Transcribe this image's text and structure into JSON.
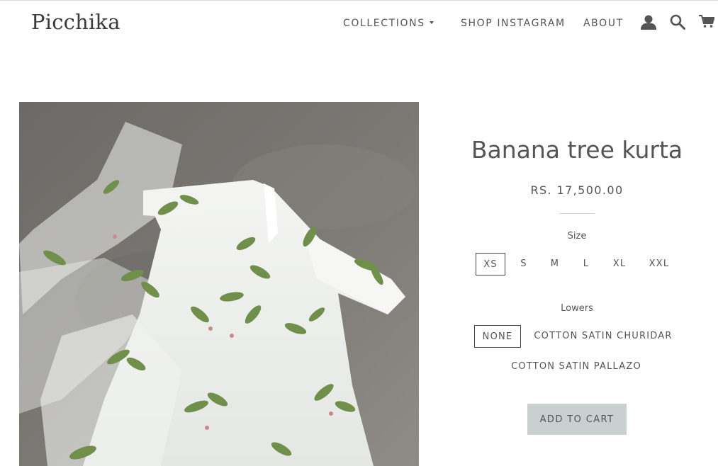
{
  "header": {
    "logo": "Picchika",
    "nav": {
      "collections": "COLLECTIONS",
      "shop_instagram": "SHOP INSTAGRAM",
      "about": "ABOUT"
    },
    "icons": [
      "user-icon",
      "search-icon",
      "cart-icon"
    ]
  },
  "product": {
    "title": "Banana tree kurta",
    "price": "RS. 17,500.00",
    "image": "white-kurta-banana-leaf-print-photo",
    "size": {
      "label": "Size",
      "options": [
        "XS",
        "S",
        "M",
        "L",
        "XL",
        "XXL"
      ],
      "selected": "XS"
    },
    "lowers": {
      "label": "Lowers",
      "options": [
        "NONE",
        "COTTON SATIN CHURIDAR",
        "COTTON SATIN PALLAZO"
      ],
      "selected": "NONE"
    },
    "add_to_cart": "ADD TO CART"
  },
  "colors": {
    "text": "#555555",
    "button_bg": "#c9d0cf",
    "selected_border": "#444444"
  }
}
